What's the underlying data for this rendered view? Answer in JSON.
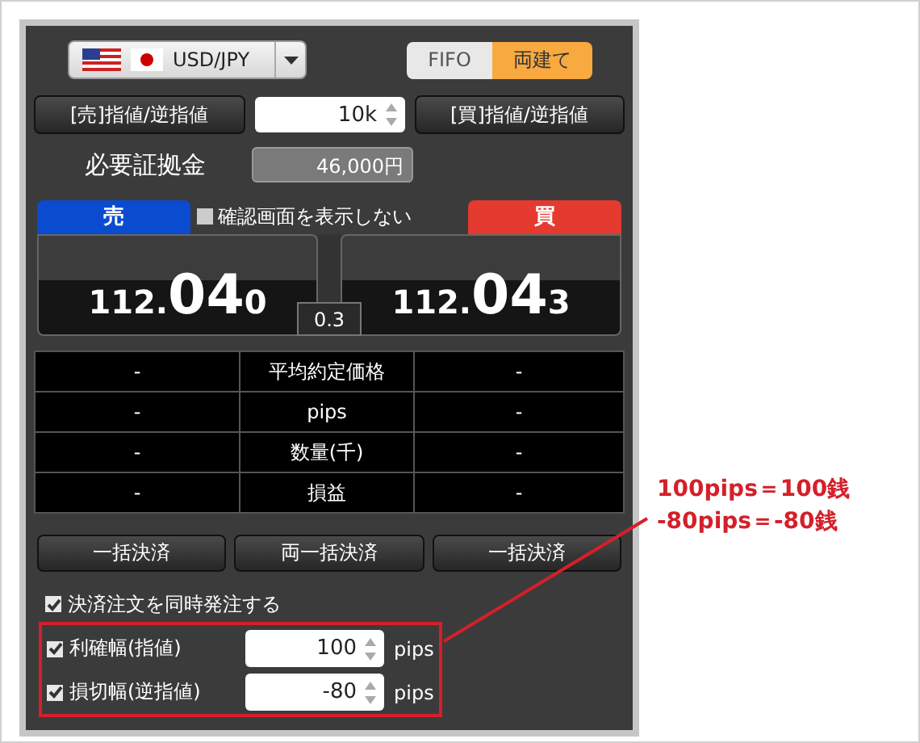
{
  "pair": {
    "label": "USD/JPY"
  },
  "mode_toggle": [
    {
      "label": "FIFO",
      "selected": false
    },
    {
      "label": "両建て",
      "selected": true
    }
  ],
  "order_bar": {
    "sell_button": "[売]指値/逆指値",
    "quantity": "10k",
    "buy_button": "[買]指値/逆指値"
  },
  "margin": {
    "label": "必要証拠金",
    "value": "46,000円"
  },
  "sell": {
    "label": "売",
    "price_prefix": "112.",
    "price_big": "04",
    "price_suffix": "0"
  },
  "confirm_checkbox": {
    "label": "確認画面を表示しない",
    "checked": false
  },
  "buy": {
    "label": "買",
    "price_prefix": "112.",
    "price_big": "04",
    "price_suffix": "3"
  },
  "spread": "0.3",
  "position_table": [
    [
      "-",
      "平均約定価格",
      "-"
    ],
    [
      "-",
      "pips",
      "-"
    ],
    [
      "-",
      "数量(千)",
      "-"
    ],
    [
      "-",
      "損益",
      "-"
    ]
  ],
  "settle_buttons": [
    "一括決済",
    "両一括決済",
    "一括決済"
  ],
  "simultaneous_order": {
    "label": "決済注文を同時発注する",
    "checked": true
  },
  "exit_rows": [
    {
      "label": "利確幅(指値)",
      "checked": true,
      "value": "100",
      "unit": "pips"
    },
    {
      "label": "損切幅(逆指値)",
      "checked": true,
      "value": "-80",
      "unit": "pips"
    }
  ],
  "annotation": [
    "100pips＝100銭",
    "-80pips＝-80銭"
  ]
}
